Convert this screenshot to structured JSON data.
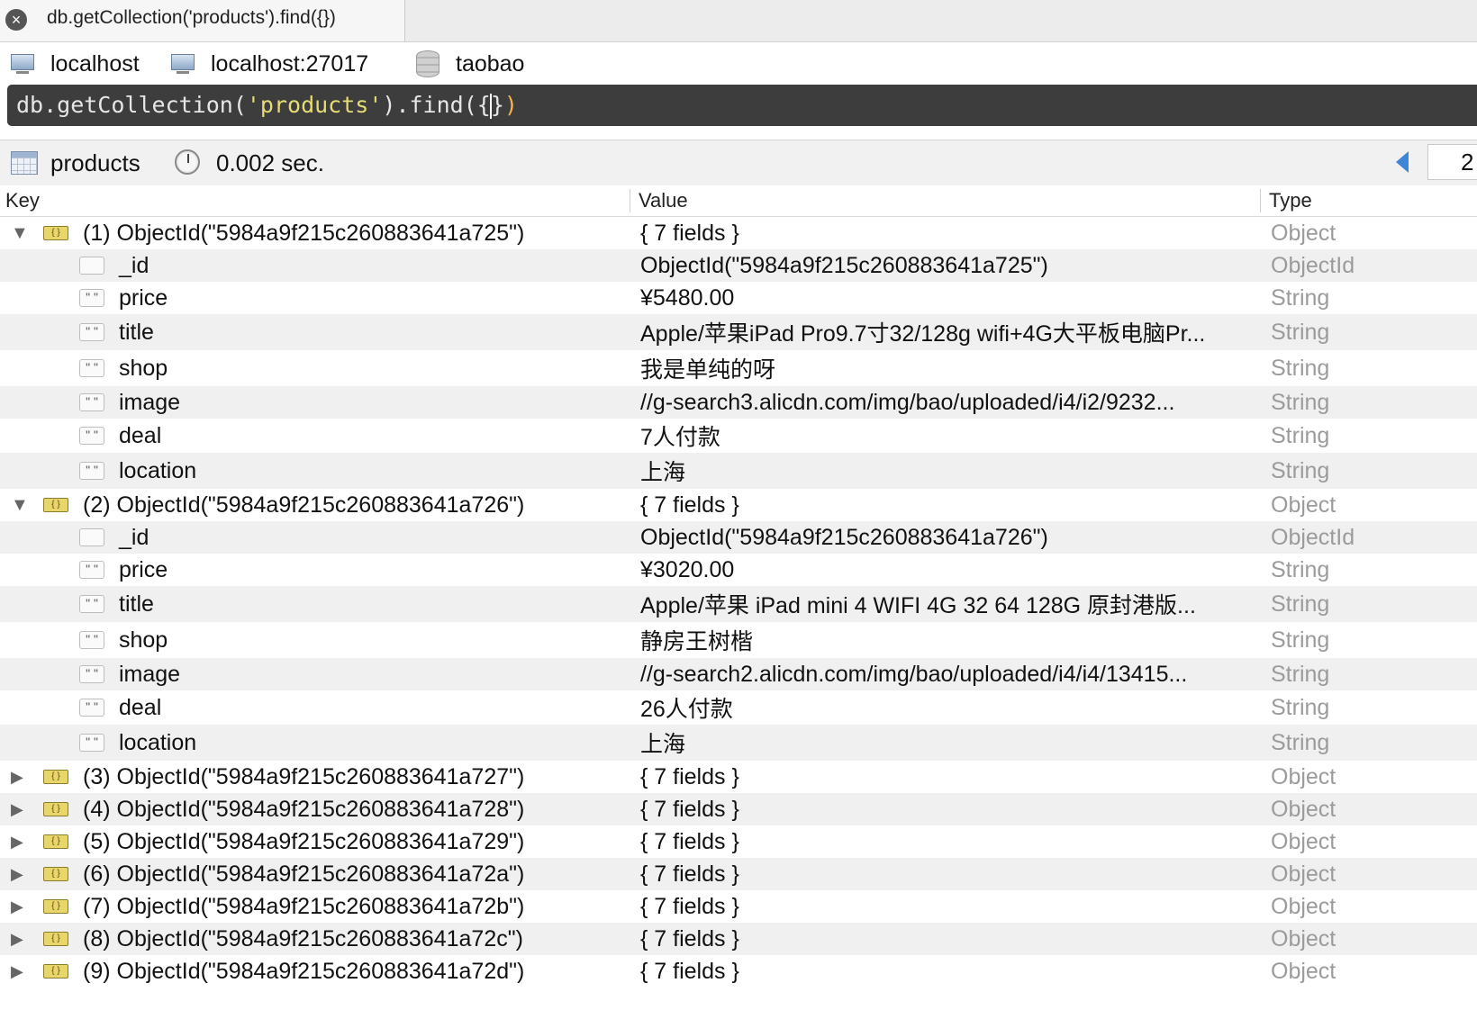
{
  "tab": {
    "title": "db.getCollection('products').find({})",
    "close_icon": "close-icon"
  },
  "connection": {
    "host": "localhost",
    "server": "localhost:27017",
    "database": "taobao"
  },
  "query": {
    "prefix": "db.getCollection(",
    "collection_literal": "'products'",
    "mid": ").find(",
    "open_paren": "(",
    "arg_open": "{",
    "arg_close": "}",
    "close_paren": ")"
  },
  "status": {
    "collection": "products",
    "elapsed": "0.002 sec.",
    "page_value": "2"
  },
  "columns": {
    "key": "Key",
    "value": "Value",
    "type": "Type"
  },
  "rows": [
    {
      "kind": "doc",
      "expanded": true,
      "key": "(1) ObjectId(\"5984a9f215c260883641a725\")",
      "value": "{ 7 fields }",
      "type": "Object"
    },
    {
      "kind": "id",
      "key": "_id",
      "value": "ObjectId(\"5984a9f215c260883641a725\")",
      "type": "ObjectId"
    },
    {
      "kind": "str",
      "key": "price",
      "value": "¥5480.00",
      "type": "String"
    },
    {
      "kind": "str",
      "key": "title",
      "value": "Apple/苹果iPad Pro9.7寸32/128g wifi+4G大平板电脑Pr...",
      "type": "String"
    },
    {
      "kind": "str",
      "key": "shop",
      "value": "我是单纯的呀",
      "type": "String"
    },
    {
      "kind": "str",
      "key": "image",
      "value": "//g-search3.alicdn.com/img/bao/uploaded/i4/i2/9232...",
      "type": "String"
    },
    {
      "kind": "str",
      "key": "deal",
      "value": "7人付款",
      "type": "String"
    },
    {
      "kind": "str",
      "key": "location",
      "value": "上海",
      "type": "String"
    },
    {
      "kind": "doc",
      "expanded": true,
      "key": "(2) ObjectId(\"5984a9f215c260883641a726\")",
      "value": "{ 7 fields }",
      "type": "Object"
    },
    {
      "kind": "id",
      "key": "_id",
      "value": "ObjectId(\"5984a9f215c260883641a726\")",
      "type": "ObjectId"
    },
    {
      "kind": "str",
      "key": "price",
      "value": "¥3020.00",
      "type": "String"
    },
    {
      "kind": "str",
      "key": "title",
      "value": "Apple/苹果 iPad mini 4 WIFI 4G 32 64 128G 原封港版...",
      "type": "String"
    },
    {
      "kind": "str",
      "key": "shop",
      "value": "静房王树楷",
      "type": "String"
    },
    {
      "kind": "str",
      "key": "image",
      "value": "//g-search2.alicdn.com/img/bao/uploaded/i4/i4/13415...",
      "type": "String"
    },
    {
      "kind": "str",
      "key": "deal",
      "value": "26人付款",
      "type": "String"
    },
    {
      "kind": "str",
      "key": "location",
      "value": "上海",
      "type": "String"
    },
    {
      "kind": "doc",
      "expanded": false,
      "key": "(3) ObjectId(\"5984a9f215c260883641a727\")",
      "value": "{ 7 fields }",
      "type": "Object"
    },
    {
      "kind": "doc",
      "expanded": false,
      "key": "(4) ObjectId(\"5984a9f215c260883641a728\")",
      "value": "{ 7 fields }",
      "type": "Object"
    },
    {
      "kind": "doc",
      "expanded": false,
      "key": "(5) ObjectId(\"5984a9f215c260883641a729\")",
      "value": "{ 7 fields }",
      "type": "Object"
    },
    {
      "kind": "doc",
      "expanded": false,
      "key": "(6) ObjectId(\"5984a9f215c260883641a72a\")",
      "value": "{ 7 fields }",
      "type": "Object"
    },
    {
      "kind": "doc",
      "expanded": false,
      "key": "(7) ObjectId(\"5984a9f215c260883641a72b\")",
      "value": "{ 7 fields }",
      "type": "Object"
    },
    {
      "kind": "doc",
      "expanded": false,
      "key": "(8) ObjectId(\"5984a9f215c260883641a72c\")",
      "value": "{ 7 fields }",
      "type": "Object"
    },
    {
      "kind": "doc",
      "expanded": false,
      "key": "(9) ObjectId(\"5984a9f215c260883641a72d\")",
      "value": "{ 7 fields }",
      "type": "Object"
    }
  ]
}
